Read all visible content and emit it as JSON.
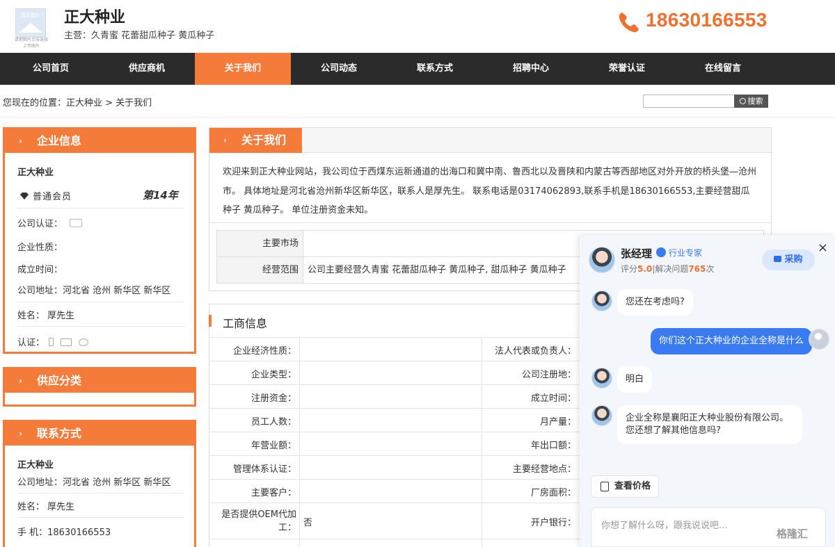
{
  "header": {
    "logo_text": "暂无图片",
    "logo_sub": "请把图片点击选择上传图片",
    "company_name": "正大种业",
    "main_business": "主营：久青蜜 花蕾甜瓜种子 黄瓜种子",
    "phone": "18630166553"
  },
  "nav": [
    "公司首页",
    "供应商机",
    "关于我们",
    "公司动态",
    "联系方式",
    "招聘中心",
    "荣誉认证",
    "在线留言"
  ],
  "nav_active_index": 2,
  "breadcrumb": "您现在的位置：正大种业 > 关于我们",
  "search": {
    "button": "搜索",
    "value": ""
  },
  "sidebar": {
    "info": {
      "title": "企业信息",
      "company": "正大种业",
      "member": "普通会员",
      "year": "第14年",
      "cert_label": "公司认证：",
      "nature_label": "企业性质：",
      "founded_label": "成立时间：",
      "address": "公司地址：河北省 沧州 新华区 新华区",
      "name": "姓名：  厚先生",
      "verify": "认证："
    },
    "category": {
      "title": "供应分类"
    },
    "contact": {
      "title": "联系方式",
      "company": "正大种业",
      "address": "公司地址：河北省 沧州 新华区 新华区",
      "name": "姓名：  厚先生",
      "mobile": "手      机：18630166553"
    }
  },
  "about": {
    "title": "关于我们",
    "intro": "欢迎来到正大种业网站，我公司位于西煤东运新通道的出海口和冀中南、鲁西北以及晋陕和内蒙古等西部地区对外开放的桥头堡—沧州市。 具体地址是河北省沧州新华区新华区，联系人是厚先生。 联系电话是03174062893,联系手机是18630166553,主要经营甜瓜种子 黄瓜种子。 单位注册资金未知。",
    "rows": [
      {
        "label": "主要市场",
        "value": ""
      },
      {
        "label": "经营范围",
        "value": "公司主要经营久青蜜 花蕾甜瓜种子 黄瓜种子, 甜瓜种子 黄瓜种子"
      }
    ]
  },
  "business": {
    "title": "工商信息",
    "left": [
      "企业经济性质：",
      "企业类型：",
      "注册资金：",
      "员工人数：",
      "年营业额：",
      "管理体系认证：",
      "主要客户：",
      "是否提供OEM代加工："
    ],
    "left_values": [
      "",
      "",
      "",
      "",
      "",
      "",
      "",
      "否"
    ],
    "right": [
      "法人代表或负责人：",
      "公司注册地：",
      "成立时间：",
      "月产量：",
      "年出口额：",
      "主要经营地点：",
      "厂房面积：",
      "开户银行："
    ]
  },
  "chat": {
    "name": "张经理",
    "expert": "行业专家",
    "rating_prefix": "评分",
    "rating": "5.0",
    "solved_prefix": "|解决问题",
    "solved": "765",
    "solved_suffix": "次",
    "buy": "采购",
    "messages": [
      {
        "from": "agent",
        "text": "您还在考虑吗?"
      },
      {
        "from": "user",
        "text": "你们这个正大种业的企业全称是什么"
      },
      {
        "from": "agent",
        "text": "明白"
      },
      {
        "from": "agent",
        "text": "企业全称是襄阳正大种业股份有限公司。您还想了解其他信息吗?"
      }
    ],
    "price_button": "查看价格",
    "input_placeholder": "你想了解什么呀，跟我说说吧...",
    "close": "×"
  },
  "watermark": "格隆汇",
  "colors": {
    "accent": "#f47b3a",
    "nav_bg": "#2b2b2b",
    "chat_blue": "#3a7bf2"
  }
}
